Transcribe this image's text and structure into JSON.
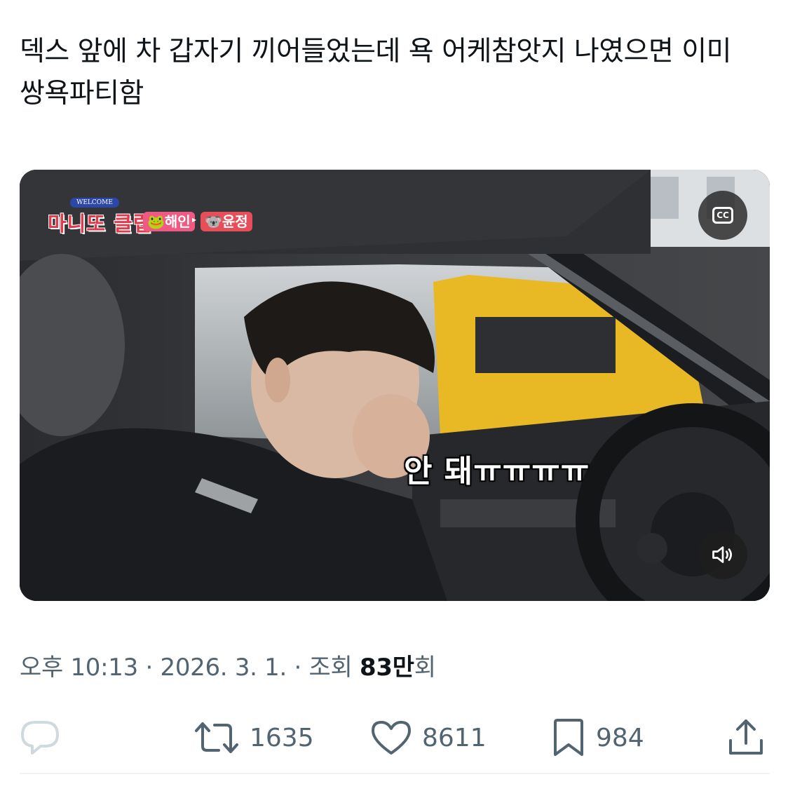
{
  "tweet": {
    "text": "덱스 앞에 차 갑자기 끼어들었는데 욕 어케참앗지 나였으면 이미 쌍욕파티함"
  },
  "media": {
    "show_logo_badge": "WELCOME",
    "show_logo": "마니또 클럽",
    "tag_from": "🐸해인",
    "tag_arrow": "▸",
    "tag_to": "🐨윤정",
    "subtitle": "안 돼ㅠㅠㅠㅠ",
    "cc_label": "CC",
    "cc_icon": "closed-captions-icon",
    "mute_icon": "speaker-muted-icon"
  },
  "meta": {
    "time": "오후 10:13",
    "separator": " · ",
    "date": "2026. 3. 1.",
    "views_label": "조회 ",
    "views_count": "83",
    "views_unit": "만",
    "views_suffix": "회"
  },
  "actions": {
    "reply": {
      "icon": "reply-bubble-icon",
      "count": ""
    },
    "retweet": {
      "icon": "retweet-icon",
      "count": "1635"
    },
    "like": {
      "icon": "heart-icon",
      "count": "8611"
    },
    "bookmark": {
      "icon": "bookmark-icon",
      "count": "984"
    },
    "share": {
      "icon": "share-icon"
    }
  },
  "colors": {
    "text_primary": "#0f1419",
    "text_secondary": "#536471",
    "reply_icon": "#cfd9de",
    "divider": "#eff3f4"
  }
}
